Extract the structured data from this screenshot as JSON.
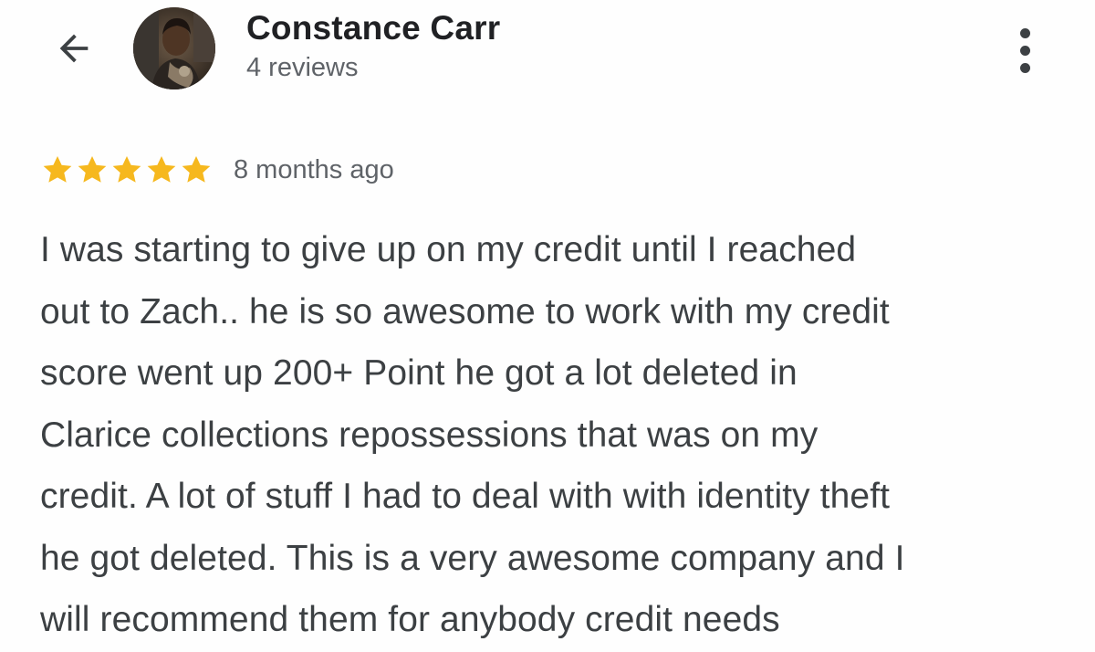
{
  "header": {
    "back_icon": "arrow-left-icon",
    "avatar_icon": "user-avatar-photo",
    "reviewer_name": "Constance Carr",
    "reviews_count": "4 reviews",
    "more_icon": "more-vert-icon"
  },
  "review": {
    "rating": 5,
    "rating_max": 5,
    "star_color": "#f6b81e",
    "time_ago": "8 months ago",
    "lines": [
      "I was starting to give up on my credit until I reached",
      "out to Zach.. he is so awesome to work with my credit",
      "score went up 200+ Point he got a lot deleted in",
      "Clarice collections repossessions that was on my",
      "credit. A lot of stuff I had to deal with with identity theft",
      "he got deleted. This is a very awesome company and I",
      "will recommend them for anybody credit needs"
    ]
  }
}
